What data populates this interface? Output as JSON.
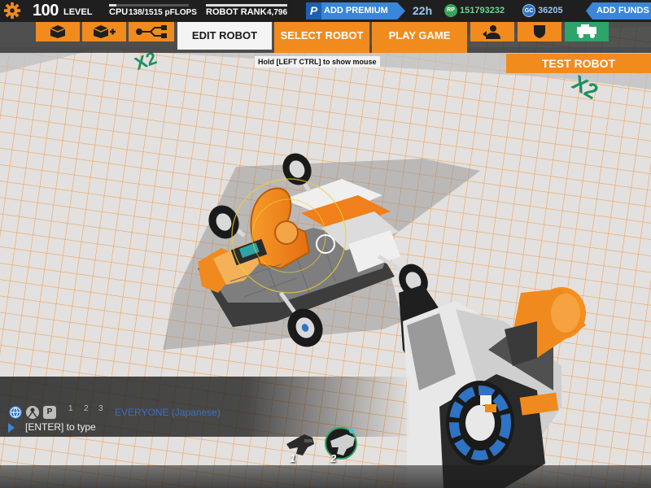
{
  "hud": {
    "level_value": "100",
    "level_label": "LEVEL",
    "cpu_label": "CPU",
    "cpu_value": "138/1515 pFLOPS",
    "cpu_fill_fraction": 0.09,
    "rank_label": "ROBOT RANK",
    "rank_value": "4,796",
    "premium_icon": "P",
    "premium_label": "ADD PREMIUM",
    "timer": "22h",
    "rp_icon": "RP",
    "rp_value": "151793232",
    "gc_icon": "GC",
    "gc_value": "36205",
    "funds_label": "ADD FUNDS"
  },
  "toolbar": {
    "edit_robot": "EDIT ROBOT",
    "select_robot": "SELECT ROBOT",
    "play_game": "PLAY GAME",
    "active_tab": "EDIT ROBOT",
    "left_icons": [
      "cube-icon",
      "cube-plus-icon",
      "connector-icon"
    ],
    "right_icons": [
      "users-icon",
      "shield-icon",
      "garage-icon"
    ]
  },
  "tip": "Hold [LEFT CTRL] to show mouse",
  "test_robot": "TEST ROBOT",
  "floor_marks": [
    "X2",
    "X2"
  ],
  "chat": {
    "tabs": [
      "1",
      "2",
      "3"
    ],
    "private_icon_letter": "P",
    "channel": "EVERYONE (Japanese)",
    "prompt": "[ENTER] to type"
  },
  "hotbar": {
    "slots": [
      {
        "number": "1",
        "icon": "smg-weapon-icon",
        "selected": false
      },
      {
        "number": "2",
        "icon": "blaster-weapon-icon",
        "selected": true
      }
    ]
  },
  "colors": {
    "accent": "#f28b1e",
    "premium_blue": "#3a86d8",
    "rp_green": "#3aa35a",
    "floor": "#dedede",
    "grid": "#f0a45a",
    "top_bar": "#1f1f1f"
  }
}
